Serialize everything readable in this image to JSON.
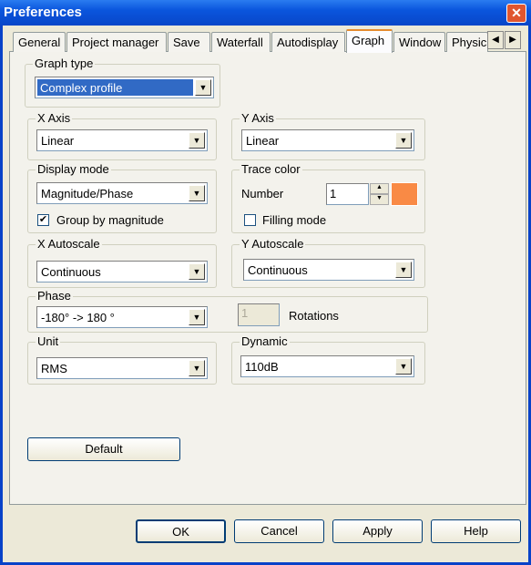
{
  "window": {
    "title": "Preferences",
    "close_icon": "close-icon"
  },
  "tabs": [
    {
      "label": "General"
    },
    {
      "label": "Project manager"
    },
    {
      "label": "Save"
    },
    {
      "label": "Waterfall"
    },
    {
      "label": "Autodisplay"
    },
    {
      "label": "Graph",
      "selected": true
    },
    {
      "label": "Window"
    },
    {
      "label": "Physic"
    }
  ],
  "graph_type": {
    "label": "Graph type",
    "value": "Complex profile"
  },
  "x_axis": {
    "label": "X Axis",
    "value": "Linear"
  },
  "y_axis": {
    "label": "Y Axis",
    "value": "Linear"
  },
  "display_mode": {
    "label": "Display mode",
    "value": "Magnitude/Phase",
    "group_by_magnitude": {
      "label": "Group by magnitude",
      "checked": true
    }
  },
  "trace_color": {
    "label": "Trace color",
    "number_label": "Number",
    "number": "1",
    "color": "#f98a45",
    "filling_mode": {
      "label": "Filling mode",
      "checked": false
    }
  },
  "x_autoscale": {
    "label": "X Autoscale",
    "value": "Continuous"
  },
  "y_autoscale": {
    "label": "Y Autoscale",
    "value": "Continuous"
  },
  "phase": {
    "label": "Phase",
    "value": "-180° -> 180 °",
    "rotations": "1",
    "rotations_label": "Rotations"
  },
  "unit": {
    "label": "Unit",
    "value": "RMS"
  },
  "dynamic": {
    "label": "Dynamic",
    "value": "110dB"
  },
  "buttons": {
    "default": "Default",
    "ok": "OK",
    "cancel": "Cancel",
    "apply": "Apply",
    "help": "Help"
  }
}
